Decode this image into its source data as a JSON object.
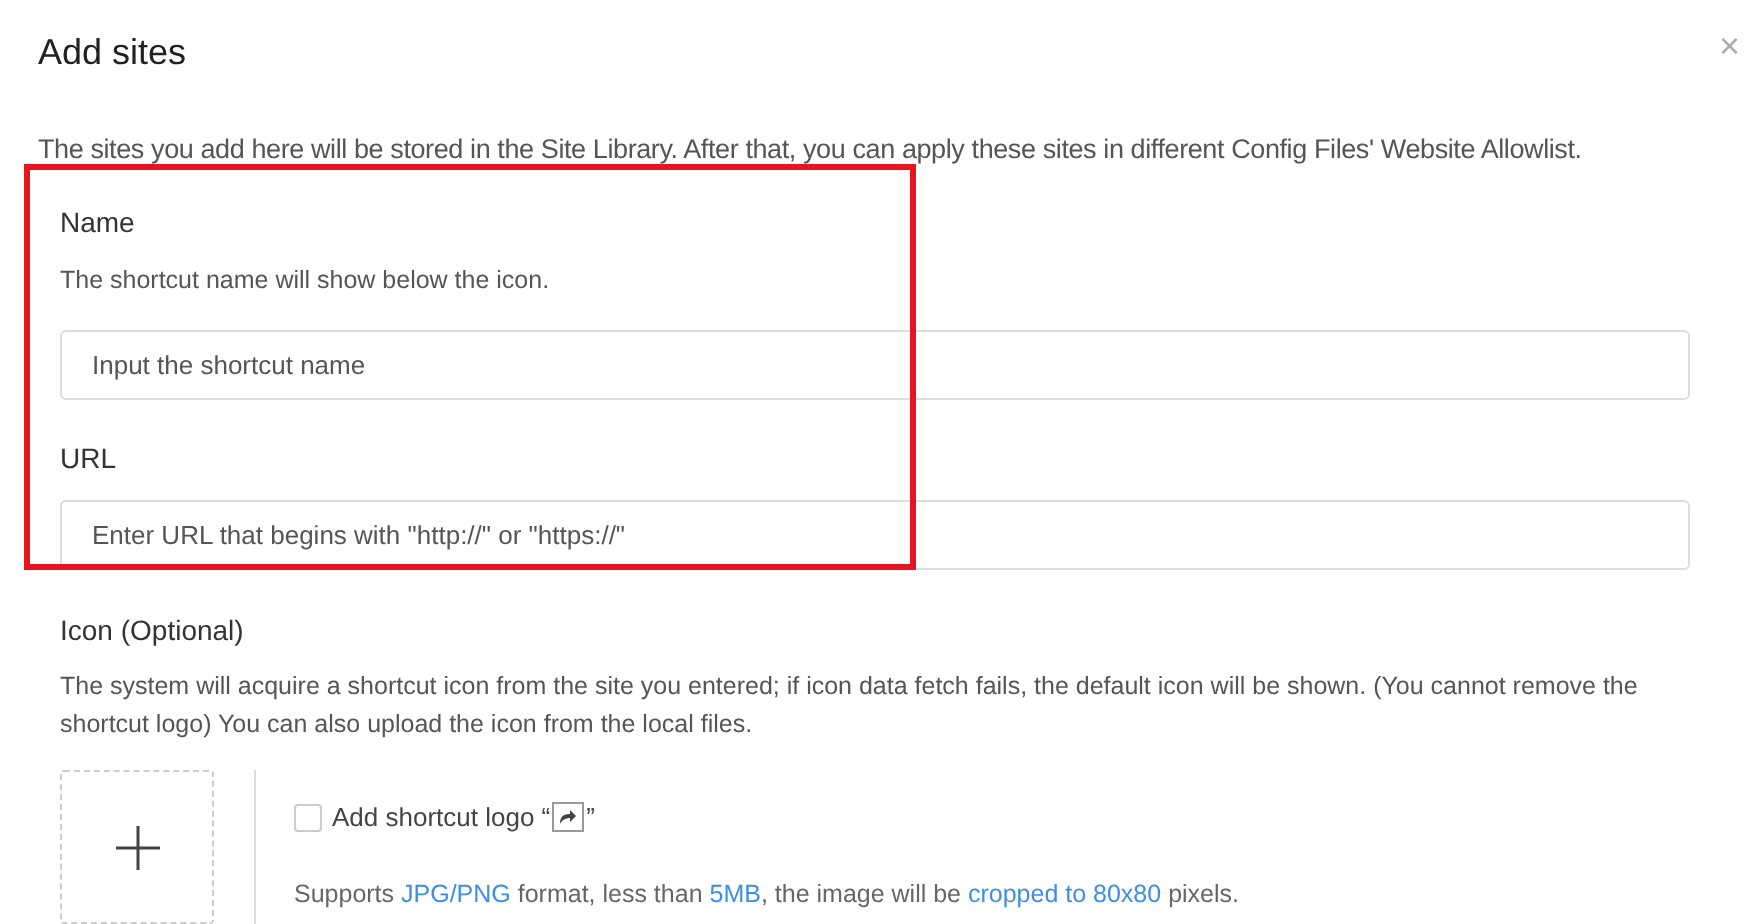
{
  "dialog": {
    "title": "Add sites",
    "close": "×",
    "description": "The sites you add here will be stored in the Site Library. After that, you can apply these sites in different Config Files' Website Allowlist."
  },
  "fields": [
    {
      "label": "Name",
      "hint": "The shortcut name will show below the icon.",
      "placeholder": "Input the shortcut name"
    },
    {
      "label": "URL",
      "placeholder": "Enter URL that begins with \"http://\" or \"https://\""
    }
  ],
  "icon_section": {
    "label": "Icon (Optional)",
    "description": "The system will acquire a shortcut icon from the site you entered; if icon data fetch fails, the default icon will be shown. (You cannot remove the shortcut logo) You can also upload the icon from the local files.",
    "checkbox": {
      "label_before": "Add shortcut logo “",
      "label_after": "”",
      "checked": false
    },
    "note": [
      {
        "kind": "text",
        "text": "Supports "
      },
      {
        "kind": "link",
        "text": "JPG/PNG"
      },
      {
        "kind": "text",
        "text": " format, less than "
      },
      {
        "kind": "link",
        "text": "5MB"
      },
      {
        "kind": "text",
        "text": ", the image will be "
      },
      {
        "kind": "link",
        "text": "cropped to 80x80"
      },
      {
        "kind": "text",
        "text": " pixels."
      }
    ]
  }
}
